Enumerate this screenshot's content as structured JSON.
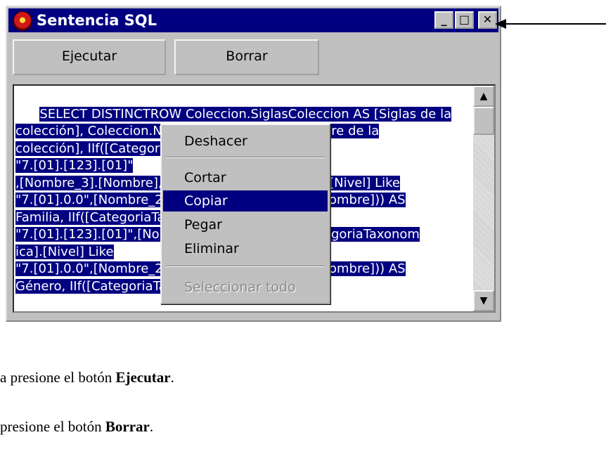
{
  "window": {
    "title": "Sentencia SQL",
    "controls": {
      "minimize": "_",
      "maximize": "□",
      "close": "✕"
    }
  },
  "buttons": {
    "execute_label": "Ejecutar",
    "delete_label": "Borrar"
  },
  "editor": {
    "lines": [
      "SELECT DISTINCTROW Coleccion.SiglasColeccion AS [Siglas de la",
      "colección], Coleccion.NombreColeccion AS [Nombre de la",
      "colección], IIf([CategoriaTaxonomica].[Nivel] Like",
      "\"7.[01].[123].[01]\"",
      ",[Nombre_3].[Nombre],IIf([CategoriaTaxonomica].[Nivel] Like",
      "\"7.[01].0.0\",[Nombre_2].[Nombre],[Nombre_1].[Nombre])) AS",
      "Familia, IIf([CategoriaTaxonomica].[Nivel] Like",
      "\"7.[01].[123].[01]\",[Nombre_2].[Nombre],IIf([CategoriaTaxonom",
      "ica].[Nivel] Like",
      "\"7.[01].0.0\",[Nombre_2].[Nombre],[Nombre_1].[Nombre])) AS",
      "Género, IIf([CategoriaTaxonomica].[Nivel] Like"
    ],
    "scroll_up": "▲",
    "scroll_down": "▼"
  },
  "context_menu": {
    "undo": "Deshacer",
    "cut": "Cortar",
    "copy": "Copiar",
    "paste": "Pegar",
    "delete": "Eliminar",
    "select_all": "Seleccionar todo",
    "selected_item": "Copiar"
  },
  "instructions": [
    {
      "prefix": "a presione el botón ",
      "bold": "Ejecutar",
      "suffix": "."
    },
    {
      "prefix": "presione el botón ",
      "bold": "Borrar",
      "suffix": "."
    }
  ],
  "colors": {
    "titlebar": "#000080",
    "selection": "#000080",
    "window_face": "#c0c0c0"
  }
}
